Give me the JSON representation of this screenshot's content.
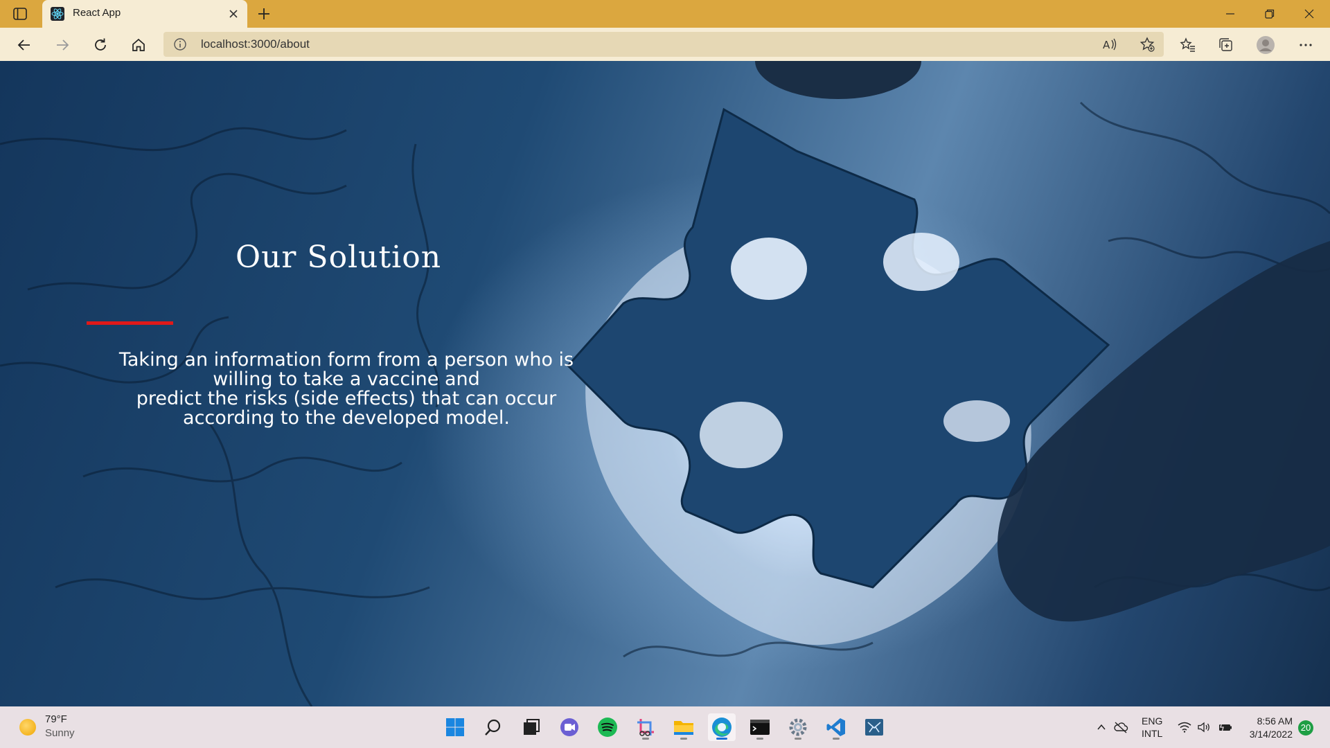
{
  "browser": {
    "tab_title": "React App",
    "url": "localhost:3000/about"
  },
  "page": {
    "heading": "Our Solution",
    "description_lines": [
      "Taking an information form from a person who is",
      "willing to take a vaccine and",
      "predict the risks (side effects) that can occur",
      "according to the developed model."
    ],
    "accent_color": "#e01919"
  },
  "taskbar": {
    "weather_temp": "79°F",
    "weather_condition": "Sunny",
    "lang_primary": "ENG",
    "lang_secondary": "INTL",
    "time": "8:56 AM",
    "date": "3/14/2022",
    "notification_count": "20"
  }
}
